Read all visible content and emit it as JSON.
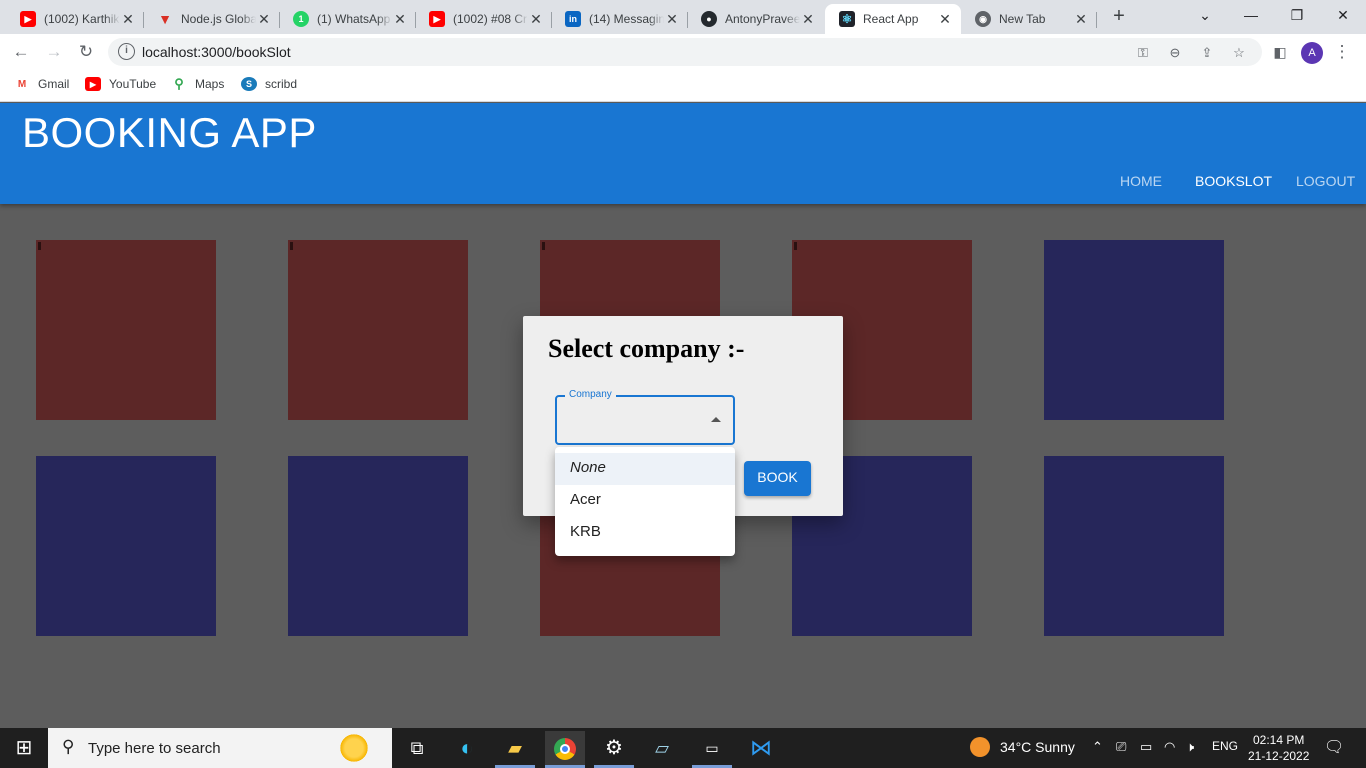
{
  "browser": {
    "tabs": [
      {
        "title": "(1002) Karthik",
        "icon": "youtube-icon",
        "color": "#ff0000"
      },
      {
        "title": "Node.js Global",
        "icon": "vercel-icon",
        "color": "#d93025"
      },
      {
        "title": "(1) WhatsApp",
        "icon": "whatsapp-icon",
        "color": "#25d366"
      },
      {
        "title": "(1002) #08 Cr",
        "icon": "youtube-icon",
        "color": "#ff0000"
      },
      {
        "title": "(14) Messaging",
        "icon": "linkedin-icon",
        "color": "#0a66c2"
      },
      {
        "title": "AntonyPraveen",
        "icon": "github-icon",
        "color": "#24292e"
      },
      {
        "title": "React App",
        "icon": "react-icon",
        "color": "#20232a",
        "active": true
      },
      {
        "title": "New Tab",
        "icon": "chrome-icon",
        "color": "#5f6368"
      }
    ],
    "url": "localhost:3000/bookSlot",
    "avatar_initial": "A",
    "bookmarks": [
      {
        "label": "Gmail",
        "icon": "gmail-icon",
        "color": "#ea4335"
      },
      {
        "label": "YouTube",
        "icon": "youtube-icon",
        "color": "#ff0000"
      },
      {
        "label": "Maps",
        "icon": "maps-icon",
        "color": "#34a853"
      },
      {
        "label": "scribd",
        "icon": "scribd-icon",
        "color": "#1a7bba"
      }
    ]
  },
  "app": {
    "brand": "BOOKING APP",
    "nav": {
      "home": "HOME",
      "bookslot": "BOOKSLOT",
      "logout": "LOGOUT"
    },
    "colors": {
      "primary": "#1976d2",
      "booked": "#5c2727",
      "available": "#26265a"
    }
  },
  "slots": [
    {
      "status": "booked"
    },
    {
      "status": "booked"
    },
    {
      "status": "booked"
    },
    {
      "status": "booked"
    },
    {
      "status": "available"
    },
    {
      "status": "available"
    },
    {
      "status": "available"
    },
    {
      "status": "booked"
    },
    {
      "status": "available"
    },
    {
      "status": "available"
    }
  ],
  "dialog": {
    "title": "Select company :-",
    "field_label": "Company",
    "selected_value": "",
    "book_label": "BOOK",
    "options": [
      "None",
      "Acer",
      "KRB"
    ]
  },
  "taskbar": {
    "search_placeholder": "Type here to search",
    "weather": "34°C  Sunny",
    "language": "ENG",
    "time": "02:14 PM",
    "date": "21-12-2022"
  }
}
